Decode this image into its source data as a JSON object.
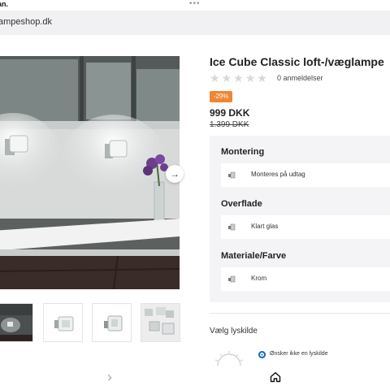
{
  "status": {
    "time": "an.",
    "dots": "•••"
  },
  "browser": {
    "url": "ampeshop.dk"
  },
  "gallery": {
    "next_arrow": "→",
    "thumbnails": [
      {
        "name": "thumb-dark-room"
      },
      {
        "name": "thumb-lamp-front"
      },
      {
        "name": "thumb-lamp-side"
      },
      {
        "name": "thumb-lamp-wall"
      }
    ],
    "thumb_next": "›"
  },
  "product": {
    "title": "Ice Cube Classic loft-/væglampe",
    "rating_stars": 5,
    "rating_filled": 0,
    "reviews": "0 anmeldelser",
    "discount": "-29%",
    "price": "999 DKK",
    "old_price": "1.399 DKK"
  },
  "options": [
    {
      "heading": "Montering",
      "value": "Monteres på udtag"
    },
    {
      "heading": "Overflade",
      "value": "Klart glas"
    },
    {
      "heading": "Materiale/Farve",
      "value": "Krom"
    }
  ],
  "light_source": {
    "heading": "Vælg lyskilde",
    "option_label": "Ønsker ikke en lyskilde"
  },
  "colors": {
    "accent_badge": "#f08632",
    "radio": "#1668c7",
    "panel": "#f4f4f6"
  },
  "icons": [
    "home-icon",
    "bulb-icon",
    "lamp-icon",
    "star-icon",
    "arrow-right-icon",
    "chevron-right-icon"
  ]
}
